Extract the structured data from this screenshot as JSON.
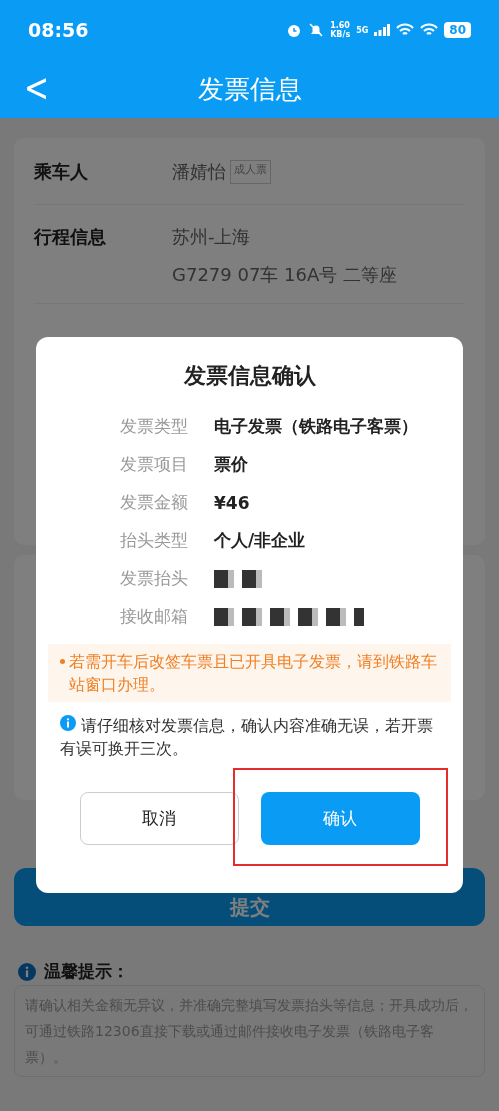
{
  "status_bar": {
    "time": "08:56",
    "speed_value": "1.60",
    "speed_unit": "KB/s",
    "network": "5G",
    "battery": "80"
  },
  "header": {
    "back": "<",
    "title": "发票信息"
  },
  "passenger": {
    "label": "乘车人",
    "name": "潘婧怡",
    "tag": "成人票"
  },
  "trip": {
    "label": "行程信息",
    "route": "苏州-上海",
    "seat": "G7279 07车 16A号 二等座"
  },
  "submit": "提交",
  "tips": {
    "title": "温馨提示：",
    "text": "请确认相关金额无异议，并准确完整填写发票抬头等信息；开具成功后，可通过铁路12306直接下载或通过邮件接收电子发票（铁路电子客票）。"
  },
  "dialog": {
    "title": "发票信息确认",
    "rows": [
      {
        "label": "发票类型",
        "kind": "text",
        "value": "电子发票（铁路电子客票）"
      },
      {
        "label": "发票项目",
        "kind": "text",
        "value": "票价"
      },
      {
        "label": "发票金额",
        "kind": "text",
        "value": "¥46"
      },
      {
        "label": "抬头类型",
        "kind": "text",
        "value": "个人/非企业"
      },
      {
        "label": "发票抬头",
        "kind": "redacted"
      },
      {
        "label": "接收邮箱",
        "kind": "redacted"
      }
    ],
    "warning": "若需开车后改签车票且已开具电子发票，请到铁路车站窗口办理。",
    "info": "请仔细核对发票信息，确认内容准确无误，若开票有误可换开三次。",
    "cancel": "取消",
    "confirm": "确认"
  }
}
